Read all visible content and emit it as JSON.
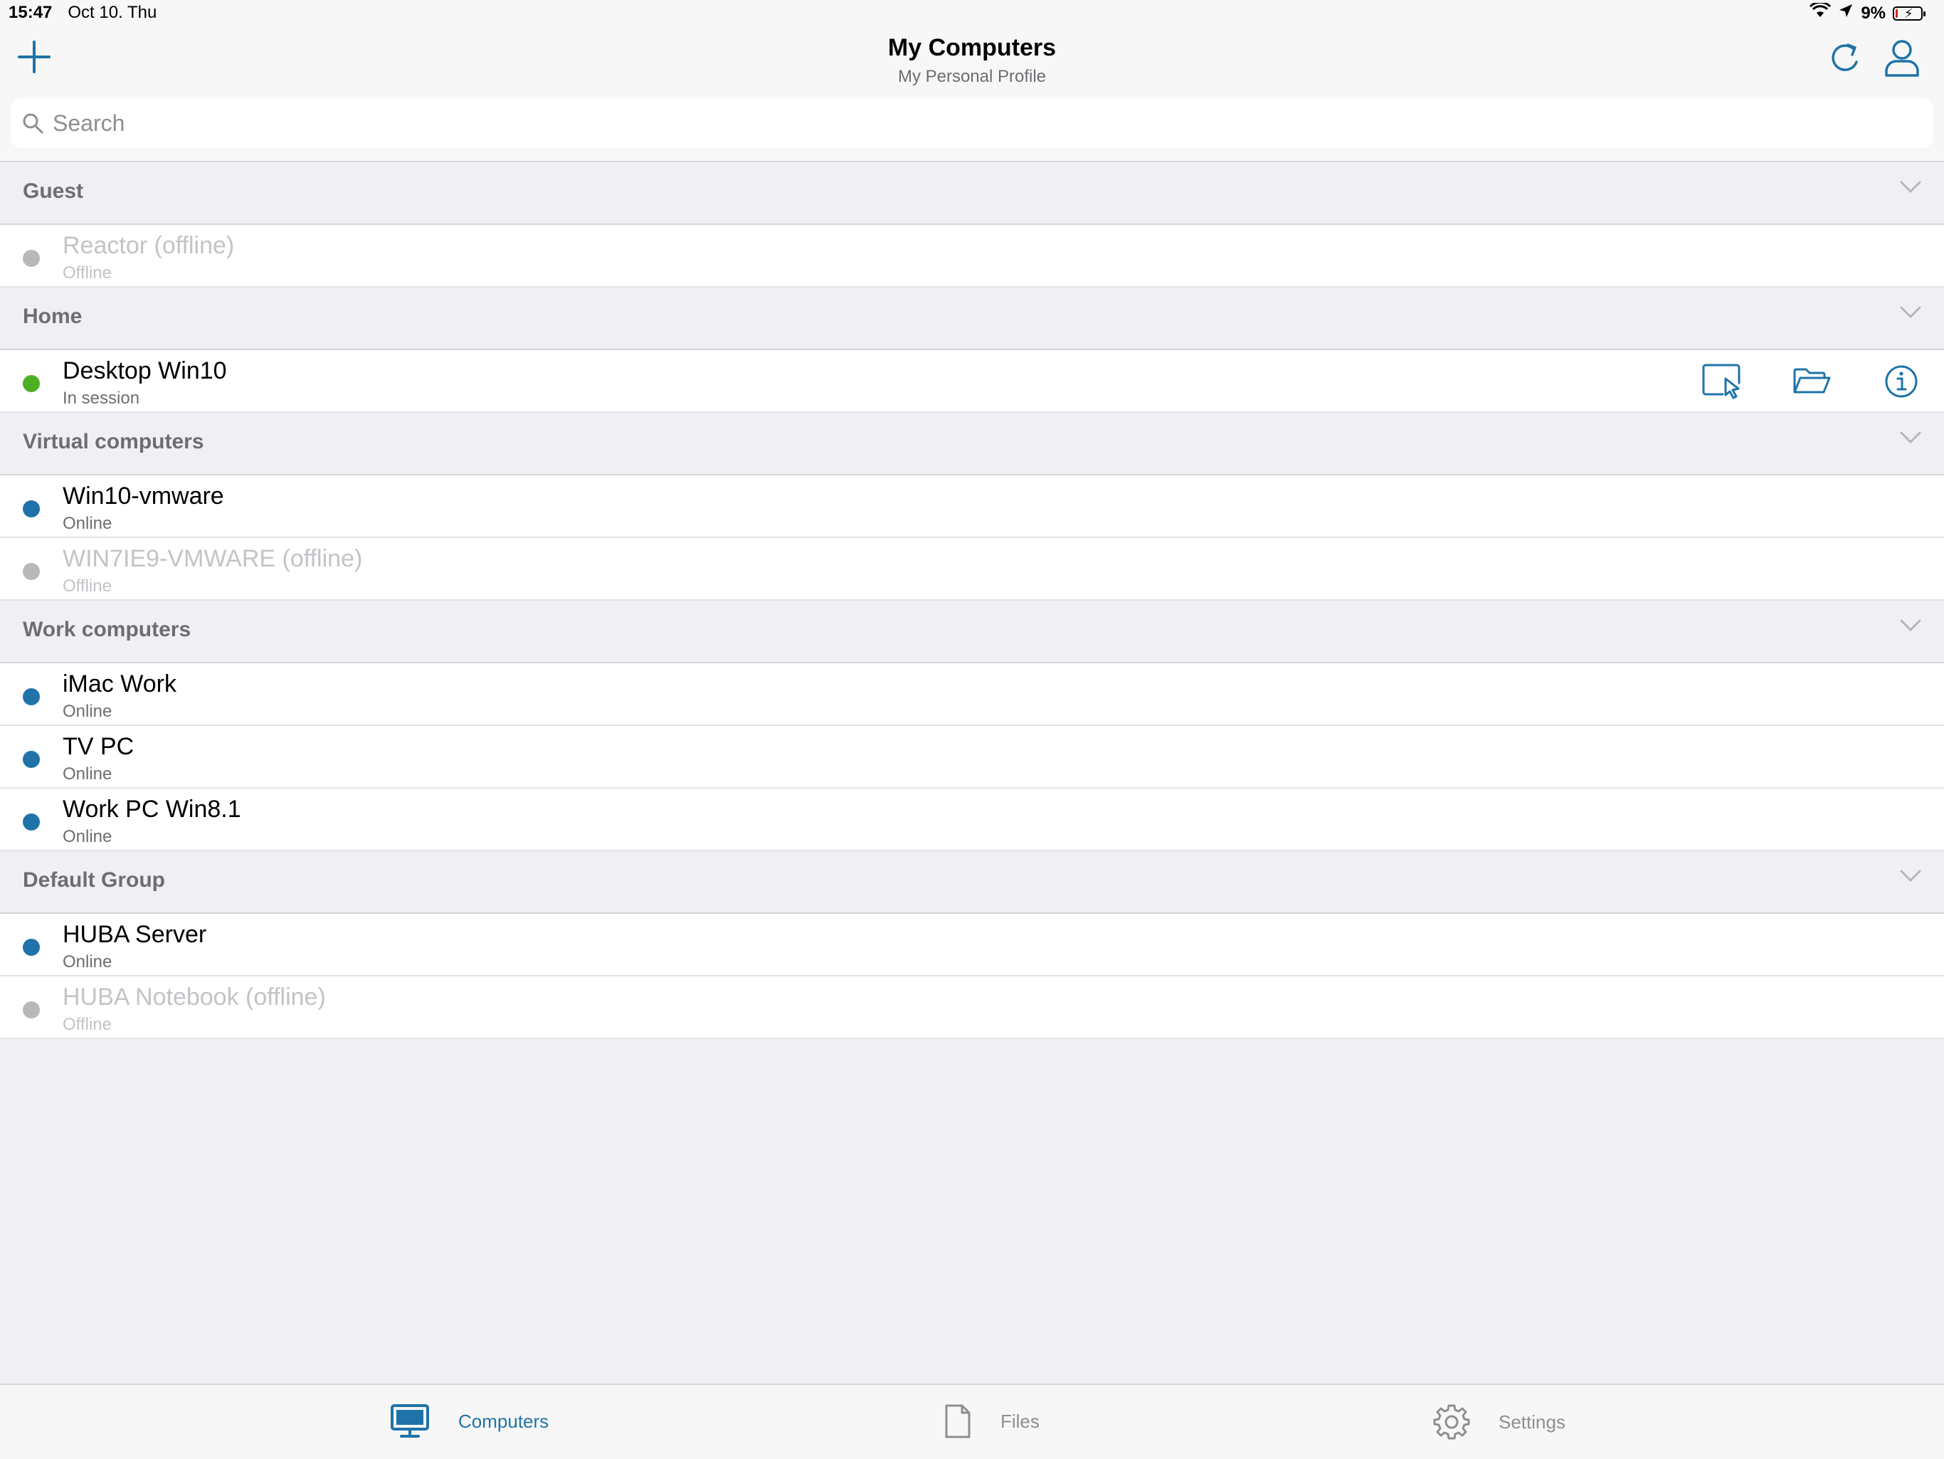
{
  "status_bar": {
    "time": "15:47",
    "date": "Oct 10. Thu",
    "battery": "9%",
    "battery_level": 0.09
  },
  "header": {
    "title": "My Computers",
    "subtitle": "My Personal Profile"
  },
  "search": {
    "placeholder": "Search"
  },
  "colors": {
    "accent": "#1f73a8",
    "online": "#1f73a8",
    "in_session": "#4caf24",
    "offline": "#c3c3c8"
  },
  "groups": [
    {
      "name": "Guest",
      "computers": [
        {
          "name": "Reactor (offline)",
          "status": "Offline"
        }
      ]
    },
    {
      "name": "Home",
      "computers": [
        {
          "name": "Desktop Win10",
          "status": "In session"
        }
      ]
    },
    {
      "name": "Virtual computers",
      "computers": [
        {
          "name": "Win10-vmware",
          "status": "Online"
        },
        {
          "name": "WIN7IE9-VMWARE (offline)",
          "status": "Offline"
        }
      ]
    },
    {
      "name": "Work computers",
      "computers": [
        {
          "name": "iMac Work",
          "status": "Online"
        },
        {
          "name": "TV PC",
          "status": "Online"
        },
        {
          "name": "Work PC Win8.1",
          "status": "Online"
        }
      ]
    },
    {
      "name": "Default Group",
      "computers": [
        {
          "name": "HUBA Server",
          "status": "Online"
        },
        {
          "name": "HUBA Notebook (offline)",
          "status": "Offline"
        }
      ]
    }
  ],
  "tabs": [
    {
      "label": "Computers",
      "icon": "monitor-icon",
      "active": true
    },
    {
      "label": "Files",
      "icon": "file-icon",
      "active": false
    },
    {
      "label": "Settings",
      "icon": "gear-icon",
      "active": false
    }
  ]
}
